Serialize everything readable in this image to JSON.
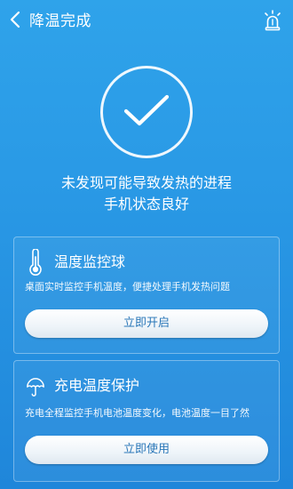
{
  "header": {
    "title": "降温完成",
    "back_icon": "chevron-left-icon",
    "right_icon": "alarm-light-icon"
  },
  "status": {
    "icon": "checkmark-icon",
    "line1": "未发现可能导致发热的进程",
    "line2": "手机状态良好"
  },
  "cards": [
    {
      "icon": "thermometer-icon",
      "title": "温度监控球",
      "description": "桌面实时监控手机温度，便捷处理手机发热问题",
      "button_label": "立即开启"
    },
    {
      "icon": "umbrella-icon",
      "title": "充电温度保护",
      "description": "充电全程监控手机电池温度变化，电池温度一目了然",
      "button_label": "立即使用"
    }
  ],
  "colors": {
    "background_top": "#2fa3ea",
    "background_bottom": "#1f86da",
    "button_text": "#2a77b8"
  }
}
